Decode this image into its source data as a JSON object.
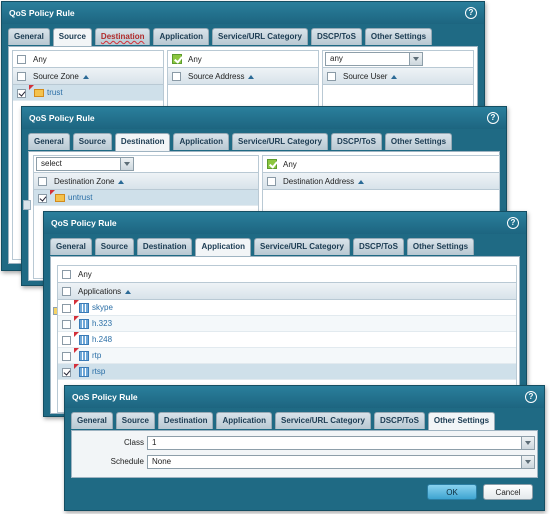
{
  "d1": {
    "title": "QoS Policy Rule",
    "help": "?",
    "tabs": [
      "General",
      "Source",
      "Destination",
      "Application",
      "Service/URL Category",
      "DSCP/ToS",
      "Other Settings"
    ],
    "any_label": "Any",
    "any_label2": "Any",
    "src_user_select": "any",
    "col_zone": "Source Zone",
    "col_addr": "Source Address",
    "col_user": "Source User",
    "zone_row": "trust"
  },
  "d2": {
    "title": "QoS Policy Rule",
    "help": "?",
    "tabs": [
      "General",
      "Source",
      "Destination",
      "Application",
      "Service/URL Category",
      "DSCP/ToS",
      "Other Settings"
    ],
    "select_label": "select",
    "any_label": "Any",
    "col_zone": "Destination Zone",
    "col_addr": "Destination Address",
    "zone_row": "untrust"
  },
  "d3": {
    "title": "QoS Policy Rule",
    "help": "?",
    "tabs": [
      "General",
      "Source",
      "Destination",
      "Application",
      "Service/URL Category",
      "DSCP/ToS",
      "Other Settings"
    ],
    "any_label": "Any",
    "col_apps": "Applications",
    "apps": [
      {
        "name": "skype",
        "checked": false
      },
      {
        "name": "h.323",
        "checked": false
      },
      {
        "name": "h.248",
        "checked": false
      },
      {
        "name": "rtp",
        "checked": false
      },
      {
        "name": "rtsp",
        "checked": true
      }
    ]
  },
  "d4": {
    "title": "QoS Policy Rule",
    "help": "?",
    "tabs": [
      "General",
      "Source",
      "Destination",
      "Application",
      "Service/URL Category",
      "DSCP/ToS",
      "Other Settings"
    ],
    "class_label": "Class",
    "class_value": "1",
    "schedule_label": "Schedule",
    "schedule_value": "None",
    "ok": "OK",
    "cancel": "Cancel"
  }
}
